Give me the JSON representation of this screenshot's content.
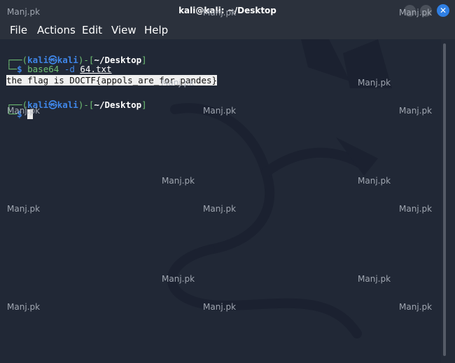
{
  "window": {
    "title": "kali@kali: ~/Desktop"
  },
  "menu": [
    "File",
    "Actions",
    "Edit",
    "View",
    "Help"
  ],
  "terminal": {
    "prompt1": {
      "open": "┌──(",
      "user": "kali",
      "at": "㉿",
      "host": "kali",
      "mid": ")-[",
      "path": "~/Desktop",
      "close": "]"
    },
    "cmd_line": {
      "corner": "└─",
      "dollar": "$",
      "cmd": "base64",
      "flag": "-d",
      "file": "64.txt"
    },
    "output": "the flag is DOCTF{appols_are_for_pandes}",
    "prompt2": {
      "open": "┌──(",
      "user": "kali",
      "at": "㉿",
      "host": "kali",
      "mid": ")-[",
      "path": "~/Desktop",
      "close": "]"
    },
    "cmd_line2": {
      "corner": "└─",
      "dollar": "$"
    }
  },
  "watermark": "Manj.pk",
  "colors": {
    "accent": "#3f86e8",
    "close": "#2f7fe4",
    "background": "#212836"
  }
}
